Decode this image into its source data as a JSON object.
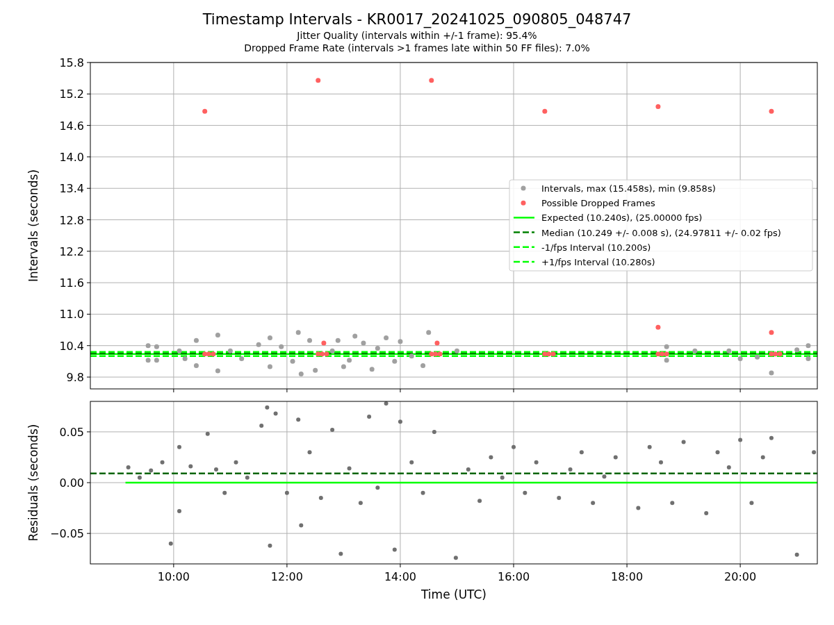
{
  "figure": {
    "title": "Timestamp Intervals - KR0017_20241025_090805_048747",
    "subtitles": [
      "Jitter Quality (intervals within +/-1 frame): 95.4%",
      "Dropped Frame Rate (intervals >1 frames late within 50 FF files): 7.0%"
    ]
  },
  "top_plot": {
    "chart_data": {
      "type": "scatter",
      "ylabel": "Intervals (seconds)",
      "xlim": [
        8.53,
        21.36
      ],
      "ylim": [
        9.575,
        15.8
      ],
      "grid": true,
      "legend": true,
      "yticks": [
        {
          "value": 9.8,
          "label": "9.8"
        },
        {
          "value": 10.4,
          "label": "10.4"
        },
        {
          "value": 11.0,
          "label": "11.0"
        },
        {
          "value": 11.6,
          "label": "11.6"
        },
        {
          "value": 12.2,
          "label": "12.2"
        },
        {
          "value": 12.8,
          "label": "12.8"
        },
        {
          "value": 13.4,
          "label": "13.4"
        },
        {
          "value": 14.0,
          "label": "14.0"
        },
        {
          "value": 14.6,
          "label": "14.6"
        },
        {
          "value": 15.2,
          "label": "15.2"
        },
        {
          "value": 15.8,
          "label": "15.8"
        }
      ],
      "series": [
        {
          "name": "Intervals, max (15.458s), min (9.858s)",
          "color": "#a0a0a0",
          "x": [
            9.55,
            9.55,
            9.7,
            9.7,
            10.1,
            10.2,
            10.4,
            10.4,
            10.78,
            10.78,
            11.0,
            11.2,
            11.5,
            11.7,
            11.7,
            11.9,
            12.1,
            12.2,
            12.25,
            12.4,
            12.5,
            12.8,
            12.9,
            13.0,
            13.1,
            13.2,
            13.35,
            13.5,
            13.6,
            13.75,
            13.9,
            14.0,
            14.2,
            14.4,
            14.5,
            15.0,
            18.7,
            18.7,
            19.2,
            19.8,
            20.0,
            20.3,
            20.55,
            21.0,
            21.2,
            21.2
          ],
          "values": [
            10.4,
            10.12,
            10.38,
            10.12,
            10.3,
            10.15,
            10.5,
            10.02,
            10.6,
            9.92,
            10.3,
            10.15,
            10.42,
            10.55,
            10.0,
            10.38,
            10.1,
            10.65,
            9.86,
            10.5,
            9.93,
            10.3,
            10.5,
            10.0,
            10.12,
            10.58,
            10.45,
            9.95,
            10.35,
            10.55,
            10.1,
            10.48,
            10.2,
            10.02,
            10.65,
            10.3,
            10.38,
            10.12,
            10.3,
            10.3,
            10.15,
            10.18,
            9.88,
            10.32,
            10.4,
            10.15
          ]
        },
        {
          "name": "Possible Dropped Frames",
          "color": "#ff6060",
          "x": [
            10.55,
            12.55,
            14.55,
            16.55,
            18.55,
            20.55,
            18.55,
            20.55,
            12.65,
            14.65,
            10.55,
            10.62,
            10.7,
            12.55,
            12.62,
            12.7,
            14.55,
            14.62,
            14.7,
            16.55,
            16.62,
            16.7,
            18.55,
            18.62,
            18.7,
            20.55,
            20.62,
            20.7
          ],
          "values": [
            14.87,
            15.46,
            15.46,
            14.87,
            14.96,
            14.87,
            10.75,
            10.65,
            10.45,
            10.45,
            10.24,
            10.24,
            10.24,
            10.24,
            10.24,
            10.24,
            10.24,
            10.24,
            10.24,
            10.24,
            10.24,
            10.24,
            10.24,
            10.24,
            10.24,
            10.24,
            10.24,
            10.24
          ]
        },
        {
          "name": "Expected (10.240s), (25.00000 fps)",
          "type": "line",
          "line_style": "solid",
          "color": "#00ff00",
          "x": [
            8.53,
            21.36
          ],
          "values": [
            10.24,
            10.24
          ]
        },
        {
          "name": "Median (10.249 +/- 0.008 s), (24.97811 +/- 0.02 fps)",
          "type": "line",
          "line_style": "dashed",
          "color": "#008000",
          "x": [
            8.53,
            21.36
          ],
          "values": [
            10.249,
            10.249
          ]
        },
        {
          "name": "-1/fps Interval (10.200s)",
          "type": "line",
          "line_style": "dashed",
          "color": "#00ff00",
          "x": [
            8.53,
            21.36
          ],
          "values": [
            10.2,
            10.2
          ]
        },
        {
          "name": "+1/fps Interval (10.280s)",
          "type": "line",
          "line_style": "dashed",
          "color": "#00ff00",
          "x": [
            8.53,
            21.36
          ],
          "values": [
            10.28,
            10.28
          ]
        }
      ]
    }
  },
  "bottom_plot": {
    "chart_data": {
      "type": "scatter",
      "xlabel": "Time (UTC)",
      "ylabel": "Residuals (seconds)",
      "xlim": [
        8.53,
        21.36
      ],
      "ylim": [
        -0.08,
        0.08
      ],
      "grid": true,
      "xticks": [
        {
          "value": 10,
          "label": "10:00"
        },
        {
          "value": 12,
          "label": "12:00"
        },
        {
          "value": 14,
          "label": "14:00"
        },
        {
          "value": 16,
          "label": "16:00"
        },
        {
          "value": 18,
          "label": "18:00"
        },
        {
          "value": 20,
          "label": "20:00"
        }
      ],
      "yticks": [
        {
          "value": 0.05,
          "label": "0.05"
        },
        {
          "value": 0,
          "label": "0.00"
        },
        {
          "value": -0.05,
          "label": "−0.05"
        }
      ],
      "series": [
        {
          "color": "#707070",
          "x": [
            9.2,
            9.4,
            9.6,
            9.8,
            9.95,
            10.1,
            10.1,
            10.3,
            10.6,
            10.75,
            10.9,
            11.1,
            11.3,
            11.55,
            11.65,
            11.7,
            11.8,
            12.0,
            12.2,
            12.25,
            12.4,
            12.6,
            12.8,
            12.95,
            13.1,
            13.3,
            13.45,
            13.6,
            13.75,
            13.9,
            14.0,
            14.2,
            14.4,
            14.6,
            14.98,
            15.2,
            15.4,
            15.6,
            15.8,
            16.0,
            16.2,
            16.4,
            16.8,
            17.0,
            17.2,
            17.4,
            17.6,
            17.8,
            18.2,
            18.4,
            18.6,
            18.8,
            19.0,
            19.4,
            19.6,
            19.8,
            20.0,
            20.2,
            20.4,
            20.55,
            21.0,
            21.3
          ],
          "values": [
            0.015,
            0.005,
            0.012,
            0.02,
            -0.06,
            0.035,
            -0.028,
            0.016,
            0.048,
            0.013,
            -0.01,
            0.02,
            0.005,
            0.056,
            0.074,
            -0.062,
            0.068,
            -0.01,
            0.062,
            -0.042,
            0.03,
            -0.015,
            0.052,
            -0.07,
            0.014,
            -0.02,
            0.065,
            -0.005,
            0.078,
            -0.066,
            0.06,
            0.02,
            -0.01,
            0.05,
            -0.074,
            0.013,
            -0.018,
            0.025,
            0.005,
            0.035,
            -0.01,
            0.02,
            -0.015,
            0.013,
            0.03,
            -0.02,
            0.006,
            0.025,
            -0.025,
            0.035,
            0.02,
            -0.02,
            0.04,
            -0.03,
            0.03,
            0.015,
            0.042,
            -0.02,
            0.025,
            0.044,
            -0.071,
            0.03
          ]
        },
        {
          "type": "line",
          "line_style": "solid",
          "color": "#00ff00",
          "x": [
            9.15,
            21.36
          ],
          "values": [
            0,
            0
          ]
        },
        {
          "type": "line",
          "line_style": "dashed",
          "color": "#006400",
          "x": [
            8.53,
            21.36
          ],
          "values": [
            0.009,
            0.009
          ]
        }
      ]
    }
  }
}
